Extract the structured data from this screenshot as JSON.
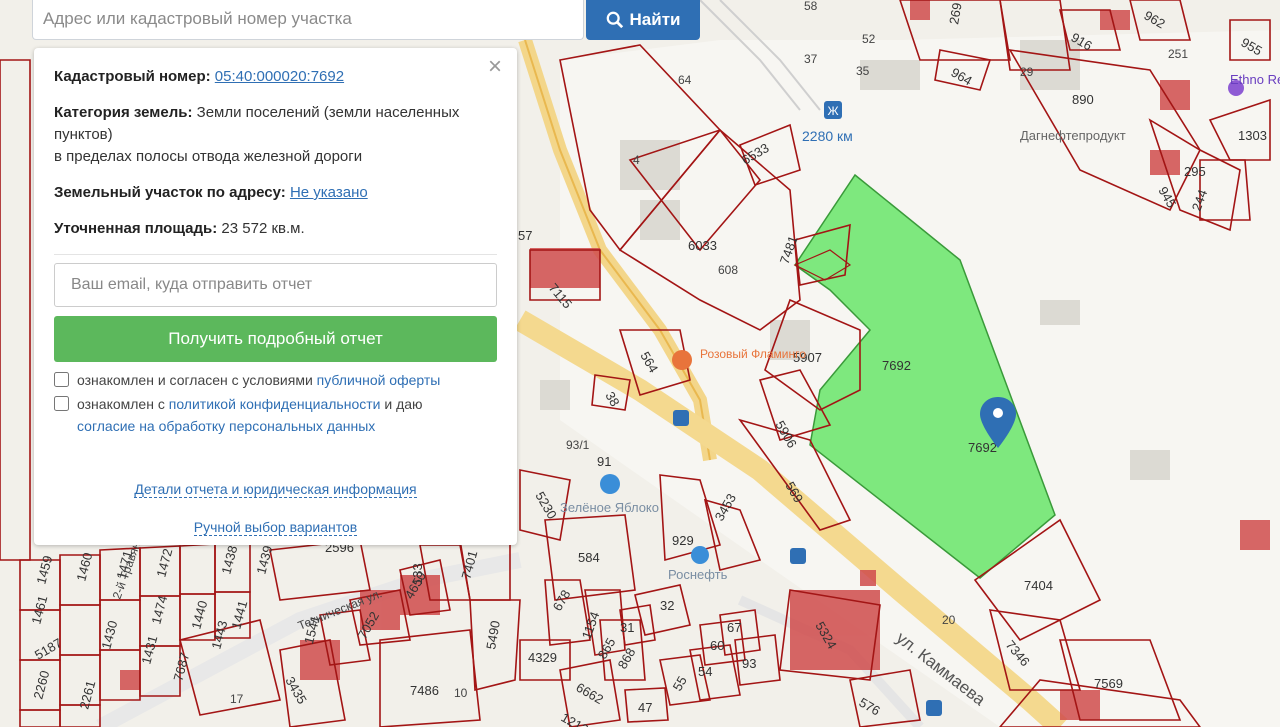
{
  "search": {
    "placeholder": "Адрес или кадастровый номер участка",
    "button_label": "Найти"
  },
  "panel": {
    "cadastral_label": "Кадастровый номер:",
    "cadastral_value": "05:40:000020:7692",
    "category_label": "Категория земель:",
    "category_value_1": "Земли поселений (земли населенных пунктов)",
    "category_value_2": "в пределах полосы отвода железной дороги",
    "address_label": "Земельный участок по адресу:",
    "address_value": "Не указано",
    "area_label": "Уточненная площадь:",
    "area_value": "23 572 кв.м.",
    "email_placeholder": "Ваш email, куда отправить отчет",
    "report_button": "Получить подробный отчет",
    "agree1_text": "ознакомлен и согласен с условиями",
    "agree1_link": "публичной оферты",
    "agree2_text": "ознакомлен с",
    "agree2_link1": "политикой конфиденциальности",
    "agree2_mid": "и даю",
    "agree2_link2": "согласие на обработку персональных данных",
    "details_link": "Детали отчета и юридическая информация",
    "manual_link": "Ручной выбор вариантов",
    "close_symbol": "×"
  },
  "map": {
    "poi": {
      "station": "2280 км",
      "flamingo": "Розовый Фламинго",
      "apple": "Зелёное Яблоко",
      "rosneft": "Роснефть",
      "dagneft": "Дагнефтепродукт",
      "ethno": "Ethno Resid"
    },
    "streets": {
      "kammaeva": "ул. Каммаева",
      "tehnicheskaya": "Техническая ул.",
      "travyanaya": "2-й Травяной"
    },
    "parcels": [
      "7692",
      "7481",
      "5907",
      "5906",
      "6033",
      "6533",
      "564",
      "7115",
      "38",
      "569",
      "5230",
      "584",
      "929",
      "3453",
      "7404",
      "7346",
      "7569",
      "5324",
      "576",
      "1541",
      "7052",
      "4650",
      "133",
      "7401",
      "5490",
      "4329",
      "678",
      "1154",
      "865",
      "868",
      "31",
      "32",
      "60",
      "67",
      "93",
      "55",
      "54",
      "6662",
      "47",
      "7486",
      "3435",
      "2596",
      "1459",
      "1460",
      "1471",
      "1472",
      "1438",
      "1439",
      "1440",
      "1441",
      "1443",
      "1430",
      "1431",
      "1474",
      "1461",
      "5187",
      "2260",
      "2261",
      "7687",
      "916",
      "962",
      "955",
      "890",
      "964",
      "1303",
      "295",
      "244",
      "945",
      "2251",
      "29",
      "64",
      "37",
      "52",
      "35",
      "58",
      "17",
      "10",
      "91",
      "93/1",
      "608",
      "20",
      "4",
      "57",
      "269",
      "1213"
    ],
    "small_labels": [
      "7692",
      "7692"
    ],
    "marker_color": "#2f6fb4",
    "highlight_color": "#7ee87e",
    "parcel_stroke": "#a31515"
  }
}
